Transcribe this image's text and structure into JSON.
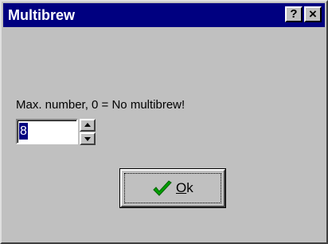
{
  "window": {
    "title": "Multibrew",
    "help_label": "?",
    "close_label": "×"
  },
  "prompt": "Max. number, 0 = No multibrew!",
  "number_field": {
    "value": "8"
  },
  "ok_button": {
    "mnemonic": "O",
    "rest": "k"
  },
  "icons": {
    "ok": "checkmark-icon",
    "spin_up": "arrow-up-icon",
    "spin_down": "arrow-down-icon"
  },
  "colors": {
    "titlebar": "#000080",
    "face": "#c0c0c0",
    "check": "#00a000"
  }
}
